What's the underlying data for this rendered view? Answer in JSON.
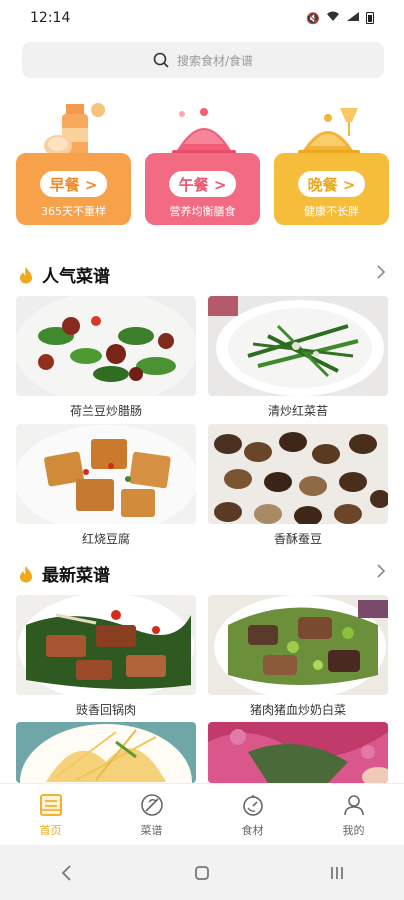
{
  "status": {
    "time": "12:14"
  },
  "search": {
    "placeholder": "搜索食材/食谱"
  },
  "meals": [
    {
      "label": "早餐 >",
      "subtitle": "365天不重样",
      "color": "#f7a24b",
      "text_color": "#ee8a2a"
    },
    {
      "label": "午餐 >",
      "subtitle": "营养均衡膳食",
      "color": "#f36b82",
      "text_color": "#e9566f"
    },
    {
      "label": "晚餐 >",
      "subtitle": "健康不长胖",
      "color": "#f5bd3a",
      "text_color": "#e9a820"
    }
  ],
  "popular": {
    "title": "人气菜谱",
    "dishes": [
      "荷兰豆炒腊肠",
      "清炒红菜苔",
      "红烧豆腐",
      "香酥蚕豆"
    ]
  },
  "latest": {
    "title": "最新菜谱",
    "dishes": [
      "豉香回锅肉",
      "猪肉猪血炒奶白菜",
      "",
      ""
    ]
  },
  "tabs": [
    {
      "label": "首页",
      "icon": "home-icon",
      "active": true
    },
    {
      "label": "菜谱",
      "icon": "recipe-icon",
      "active": false
    },
    {
      "label": "食材",
      "icon": "ingredient-icon",
      "active": false
    },
    {
      "label": "我的",
      "icon": "profile-icon",
      "active": false
    }
  ],
  "colors": {
    "accent": "#f0a81c"
  }
}
